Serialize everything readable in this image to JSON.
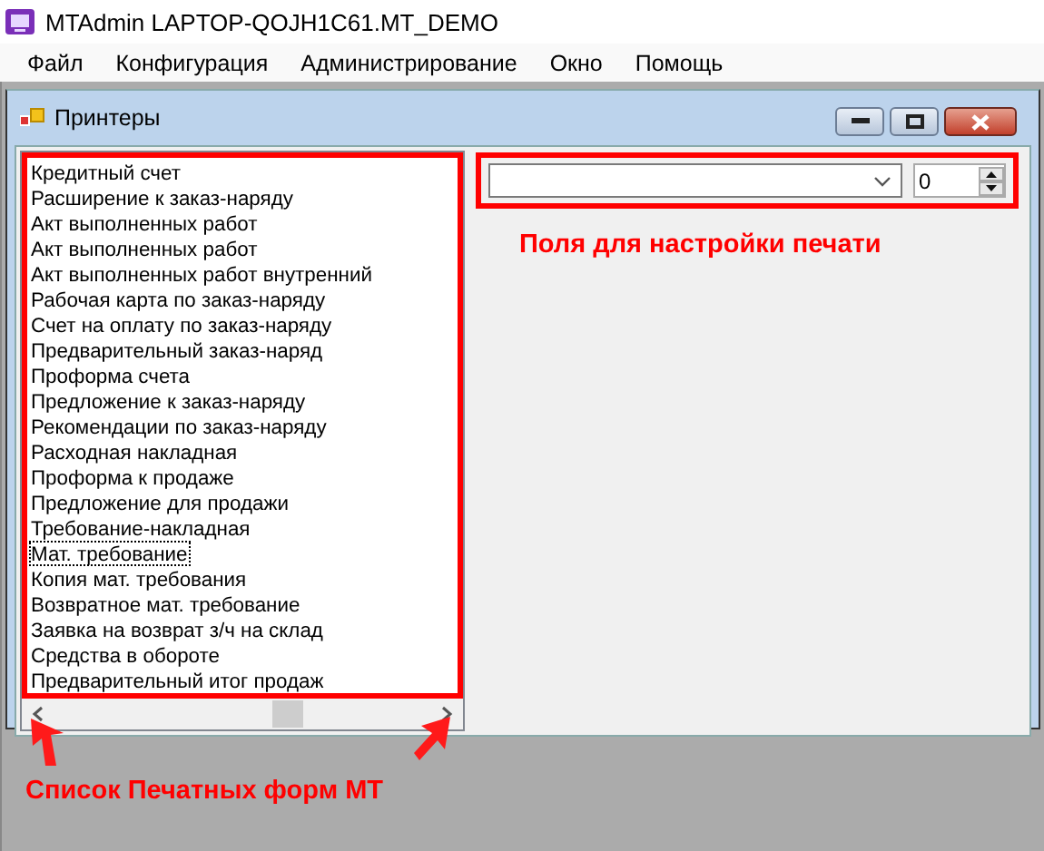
{
  "window": {
    "title": "MTAdmin LAPTOP-QOJH1C61.MT_DEMO"
  },
  "menu": [
    "Файл",
    "Конфигурация",
    "Администрирование",
    "Окно",
    "Помощь"
  ],
  "child_window": {
    "title": "Принтеры"
  },
  "print_forms": [
    {
      "label": "Кредитный счет",
      "focused": false
    },
    {
      "label": "Расширение к заказ-наряду",
      "focused": false
    },
    {
      "label": "Акт выполненных работ",
      "focused": false
    },
    {
      "label": "Акт выполненных работ",
      "focused": false
    },
    {
      "label": "Акт выполненных работ внутренний",
      "focused": false
    },
    {
      "label": "Рабочая карта по заказ-наряду",
      "focused": false
    },
    {
      "label": "Счет на оплату по заказ-наряду",
      "focused": false
    },
    {
      "label": "Предварительный заказ-наряд",
      "focused": false
    },
    {
      "label": "Проформа счета",
      "focused": false
    },
    {
      "label": "Предложение к заказ-наряду",
      "focused": false
    },
    {
      "label": "Рекомендации по заказ-наряду",
      "focused": false
    },
    {
      "label": "Расходная накладная",
      "focused": false
    },
    {
      "label": "Проформа к продаже",
      "focused": false
    },
    {
      "label": "Предложение для продажи",
      "focused": false
    },
    {
      "label": "Требование-накладная",
      "focused": false
    },
    {
      "label": "Мат. требование",
      "focused": true
    },
    {
      "label": "Копия мат. требования",
      "focused": false
    },
    {
      "label": "Возвратное мат. требование",
      "focused": false
    },
    {
      "label": "Заявка на возврат з/ч на склад",
      "focused": false
    },
    {
      "label": "Средства в обороте",
      "focused": false
    },
    {
      "label": "Предварительный итог продаж",
      "focused": false
    }
  ],
  "spin": {
    "value": "0"
  },
  "annotations": {
    "settings": "Поля для настройки печати",
    "list": "Список Печатных форм МТ"
  }
}
